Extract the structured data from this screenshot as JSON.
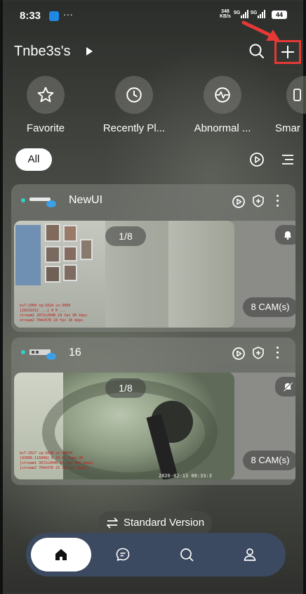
{
  "status_bar": {
    "time": "8:33",
    "more": "···",
    "net_speed_value": "348",
    "net_speed_unit": "KB/s",
    "signal1": "5G",
    "signal2": "5G",
    "battery": "44"
  },
  "header": {
    "home_name": "Tnbe3s's"
  },
  "shortcuts": [
    {
      "label": "Favorite",
      "icon": "star-icon"
    },
    {
      "label": "Recently Pl...",
      "icon": "clock-icon"
    },
    {
      "label": "Abnormal ...",
      "icon": "pulse-icon"
    },
    {
      "label": "Smar",
      "icon": "device-icon"
    }
  ],
  "filter": {
    "all_label": "All"
  },
  "devices": [
    {
      "name": "NewUI",
      "pager": "1/8",
      "cam_count": "8 CAM(s)",
      "overlay": [
        "bs7:1000 sg:1024 sz:3000",
        "[20231012 ...] 0 0 ...",
        "stream1 2072x2048 24 fps 90 kbps",
        "stream2 704x576 24 fps 18 kbps"
      ]
    },
    {
      "name": "16",
      "pager": "1/8",
      "cam_count": "8 CAM(s)",
      "overlay": [
        "bs7:1027 sg:1018 sz:30064",
        "[43006-115008] 0 33.91 Temp:34",
        "[stream1 3072x2048 24 fps 343 kbps]",
        "[stream2 704x576 23 fps 47 kbps]"
      ],
      "timestamp": "2026-02-13 08:33:3"
    }
  ],
  "bottom": {
    "standard_version": "Standard Version"
  },
  "colors": {
    "highlight": "#e53935",
    "nav_bar": "#3b4a60",
    "status_dot": "#2ed1c9"
  }
}
